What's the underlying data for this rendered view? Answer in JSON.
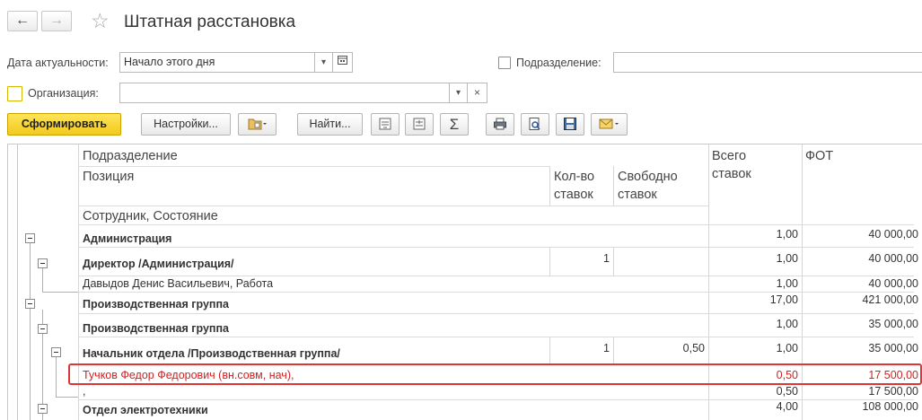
{
  "window": {
    "title": "Штатная расстановка",
    "back_icon": "←",
    "forward_icon": "→",
    "favorite_icon": "☆"
  },
  "filters": {
    "date_label": "Дата актуальности:",
    "date_value": "Начало этого дня",
    "subdivision_label": "Подразделение:",
    "subdivision_value": "",
    "organization_label": "Организация:",
    "organization_value": ""
  },
  "toolbar": {
    "generate_label": "Сформировать",
    "settings_label": "Настройки...",
    "find_label": "Найти...",
    "sum_label": "Σ"
  },
  "report": {
    "header": {
      "subdivision": "Подразделение",
      "position": "Позиция",
      "employee": "Сотрудник, Состояние",
      "rate_count_line1": "Кол-во",
      "rate_count_line2": "ставок",
      "free_line1": "Свободно",
      "free_line2": "ставок",
      "total_line1": "Всего",
      "total_line2": "ставок",
      "payroll": "ФОТ"
    },
    "rows": [
      {
        "name": "Администрация",
        "count": "",
        "free": "",
        "total": "1,00",
        "payroll": "40 000,00"
      },
      {
        "name": "Директор /Администрация/",
        "count": "1",
        "free": "",
        "total": "1,00",
        "payroll": "40 000,00"
      },
      {
        "name": "Давыдов Денис Васильевич, Работа",
        "count": "",
        "free": "",
        "total": "1,00",
        "payroll": "40 000,00"
      },
      {
        "name": "Производственная группа",
        "count": "",
        "free": "",
        "total": "17,00",
        "payroll": "421 000,00"
      },
      {
        "name": "Производственная группа",
        "count": "",
        "free": "",
        "total": "1,00",
        "payroll": "35 000,00"
      },
      {
        "name": "Начальник отдела /Производственная группа/",
        "count": "1",
        "free": "0,50",
        "total": "1,00",
        "payroll": "35 000,00"
      },
      {
        "name": "Тучков Федор Федорович (вн.совм, нач),",
        "count": "",
        "free": "",
        "total": "0,50",
        "payroll": "17 500,00"
      },
      {
        "name": ",",
        "count": "",
        "free": "",
        "total": "0,50",
        "payroll": "17 500,00"
      },
      {
        "name": "Отдел электротехники",
        "count": "",
        "free": "",
        "total": "4,00",
        "payroll": "108 000,00"
      }
    ]
  }
}
